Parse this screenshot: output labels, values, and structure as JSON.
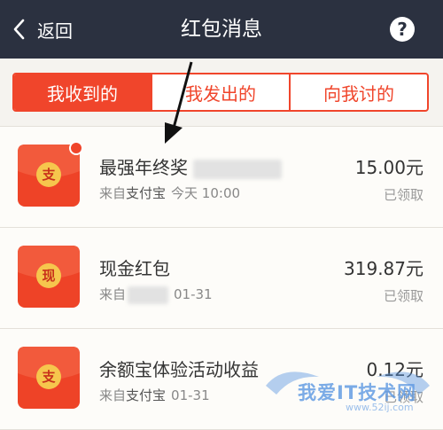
{
  "header": {
    "back_label": "返回",
    "title": "红包消息",
    "help_label": "?"
  },
  "tabs": [
    {
      "label": "我收到的",
      "active": true
    },
    {
      "label": "我发出的",
      "active": false
    },
    {
      "label": "向我讨的",
      "active": false
    }
  ],
  "items": [
    {
      "seal": "支",
      "name": "最强年终奖",
      "source_prefix": "来自",
      "source": "支付宝",
      "time": "今天 10:00",
      "amount": "15.00元",
      "status": "已领取",
      "unread": true
    },
    {
      "seal": "现",
      "name": "现金红包",
      "source_prefix": "来自",
      "source": "",
      "time": "01-31",
      "amount": "319.87元",
      "status": "已领取",
      "unread": false
    },
    {
      "seal": "支",
      "name": "余额宝体验活动收益",
      "source_prefix": "来自",
      "source": "支付宝",
      "time": "01-31",
      "amount": "0.12元",
      "status": "已领取",
      "unread": false
    }
  ],
  "watermark": {
    "text": "我爱IT技术网",
    "sub": "www.52ij.com"
  },
  "colors": {
    "header_bg": "#2b3140",
    "accent": "#f0452b",
    "envelope": "#ee4327",
    "seal": "#f6c64d"
  }
}
